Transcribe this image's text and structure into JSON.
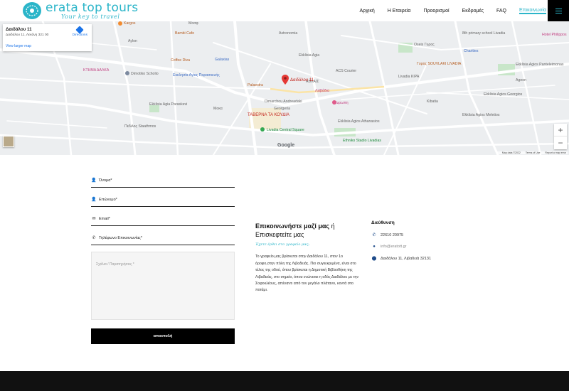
{
  "header": {
    "logo_title": "erata top tours",
    "logo_tagline": "Your key to travel",
    "nav": [
      "Αρχική",
      "Η Εταιρεία",
      "Προορισμοί",
      "Εκδρομές",
      "FAQ",
      "Επικοινωνία"
    ]
  },
  "map": {
    "card": {
      "title": "Δαιδάλου 11",
      "address": "Δαιδάλου 11, Λεκάνη 321 00",
      "view_larger": "View larger map",
      "directions": "Directions"
    },
    "pin_label": "Δαιδάλου 11",
    "places": [
      "Kargos",
      "Bambi Cafe",
      "Aylon",
      "Coffee Diva",
      "ΚΤΗΜΑ ΔΑΛΚΑ",
      "Dimotiko Scholio",
      "Εκκλησία Αγίας Παρασκευής",
      "Ekklisia Agia Paraskevi",
      "Galaxias",
      "Palaestra",
      "Astronomia",
      "Ekklisia Agia",
      "ACS Courier",
      "Oseis Γυρος",
      "ΑΒΛΑΙΣ",
      "Λεϊβάδια",
      "ΤΑΒΕΡΝΑ ΤΑ ΚΟΥΔΙΑ",
      "Livadia Central Square",
      "Ekklisia Agios Athanasios",
      "Ekklisia Agios Meletios",
      "Ethniko Stadio Livadias",
      "Πεδιλος Staathmos",
      "Ekklisia Agios Panteleimonas",
      "8th primary school Livadia",
      "Charities",
      "Hotel Philippos",
      "Livadia KIPA",
      "Γυρος SOUVLAKI LIVADIA",
      "Αgeon",
      "Kibatia",
      "Georgeria",
      "Dimarchou Andreadaki",
      "Μοσφ",
      "Μοκα",
      "Ευρωπη",
      "Ekklisia Agios Georgios"
    ],
    "zoom_in": "+",
    "zoom_out": "−",
    "logo": "Google",
    "attribution": [
      "Map data ©2022",
      "Terms of Use",
      "Report a map error"
    ]
  },
  "form": {
    "name_label": "Όνομα*",
    "surname_label": "Επώνυμο*",
    "email_label": "Email*",
    "phone_label": "Τηλέφωνο Επικοινωνίας*",
    "message_placeholder": "Σχόλια / Παρατηρήσεις *",
    "submit_label": "αποστολή"
  },
  "contact": {
    "title_bold": "Επικοινωνήστε μαζί μας",
    "title_rest": " ή Επισκεφτείτε μας",
    "subtitle": "Έχετε έρθει στο γραφείο μας;",
    "body": "Το γραφείο μας βρίσκεται στην Δαιδάλου 11, στον 1ο όροφο,στην πόλη της Λιβαδειάς. Πιο συγκεκριμένα, είναι στο τέλος της οδού, όπου βρίσκεται η Δημοτική Βιβλιοθήκη της Λιβαδειάς, στο σημείο, όπου ενώνεται η οδός Δαιδάλου με την Σοφοκλέους, απέναντι από τον μεγάλο πλάτανο, κοντά στο ποτάμι."
  },
  "address": {
    "title": "Διεύθυνση",
    "phone": "22610 20975",
    "email": "info@eratott.gr",
    "street": "Δαιδάλου 11, Λιβαδειά 32131"
  },
  "colors": {
    "accent": "#2bb5c9",
    "dark": "#000000",
    "icon": "#1f4c8a"
  }
}
